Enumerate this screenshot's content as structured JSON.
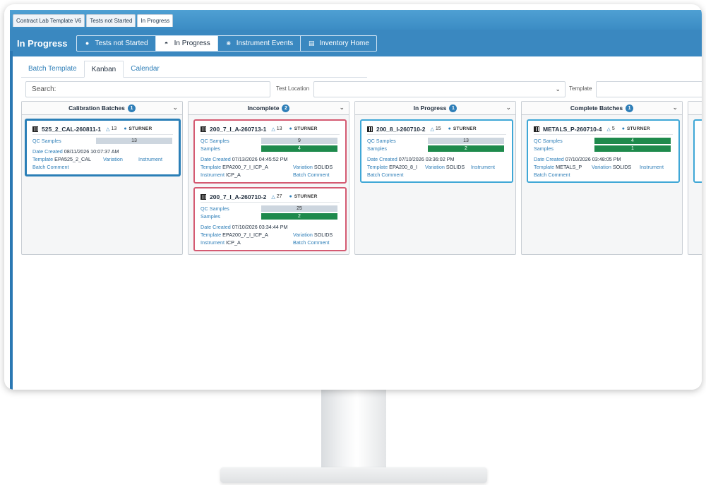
{
  "window_tabs": [
    "Contract Lab Template V6",
    "Tests not Started",
    "In Progress"
  ],
  "header": {
    "title": "In Progress",
    "nav": [
      {
        "label": "Tests not Started",
        "icon": "clock-icon",
        "active": false
      },
      {
        "label": "In Progress",
        "icon": "hourglass-icon",
        "active": true
      },
      {
        "label": "Instrument Events",
        "icon": "signal-icon",
        "active": false
      },
      {
        "label": "Inventory Home",
        "icon": "box-icon",
        "active": false
      }
    ]
  },
  "sub_tabs": [
    "Batch Template",
    "Kanban",
    "Calendar"
  ],
  "filters": {
    "search_placeholder": "Search:",
    "test_location_label": "Test Location",
    "template_label": "Template"
  },
  "labels": {
    "qc_samples": "QC Samples",
    "samples": "Samples",
    "date_created": "Date Created",
    "template": "Template",
    "variation": "Variation",
    "instrument": "Instrument",
    "batch_comment": "Batch Comment"
  },
  "columns": [
    {
      "title": "Calibration Batches",
      "count": "1",
      "cards": [
        {
          "name": "525_2_CAL-260811-1",
          "count": "13",
          "user": "STURNER",
          "qc_samples": "13",
          "date_created": "08/11/2026 10:07:37 AM",
          "template": "EPA525_2_CAL"
        }
      ]
    },
    {
      "title": "Incomplete",
      "count": "2",
      "cards": [
        {
          "name": "200_7_I_A-260713-1",
          "count": "13",
          "user": "STURNER",
          "qc_samples": "9",
          "samples": "4",
          "date_created": "07/13/2026 04:45:52 PM",
          "template": "EPA200_7_I_ICP_A",
          "variation": "SOLIDS",
          "instrument": "ICP_A"
        },
        {
          "name": "200_7_I_A-260710-2",
          "count": "27",
          "user": "STURNER",
          "qc_samples": "25",
          "samples": "2",
          "date_created": "07/10/2026 03:34:44 PM",
          "template": "EPA200_7_I_ICP_A",
          "variation": "SOLIDS",
          "instrument": "ICP_A"
        }
      ]
    },
    {
      "title": "In Progress",
      "count": "1",
      "cards": [
        {
          "name": "200_8_I-260710-2",
          "count": "15",
          "user": "STURNER",
          "qc_samples": "13",
          "samples": "2",
          "date_created": "07/10/2026 03:36:02 PM",
          "template": "EPA200_8_I",
          "variation": "SOLIDS"
        }
      ]
    },
    {
      "title": "Complete Batches",
      "count": "1",
      "cards": [
        {
          "name": "METALS_P-260710-4",
          "count": "5",
          "user": "STURNER",
          "qc_samples": "4",
          "samples": "1",
          "date_created": "07/10/2026 03:48:05 PM",
          "template": "METALS_P",
          "variation": "SOLIDS"
        }
      ]
    }
  ],
  "colors": {
    "header_blue": "#3a88c0",
    "accent_blue": "#2f7fb8",
    "incomplete_red": "#d45a72",
    "progress_cyan": "#3fa7d6",
    "samples_green": "#1e8a4c"
  }
}
